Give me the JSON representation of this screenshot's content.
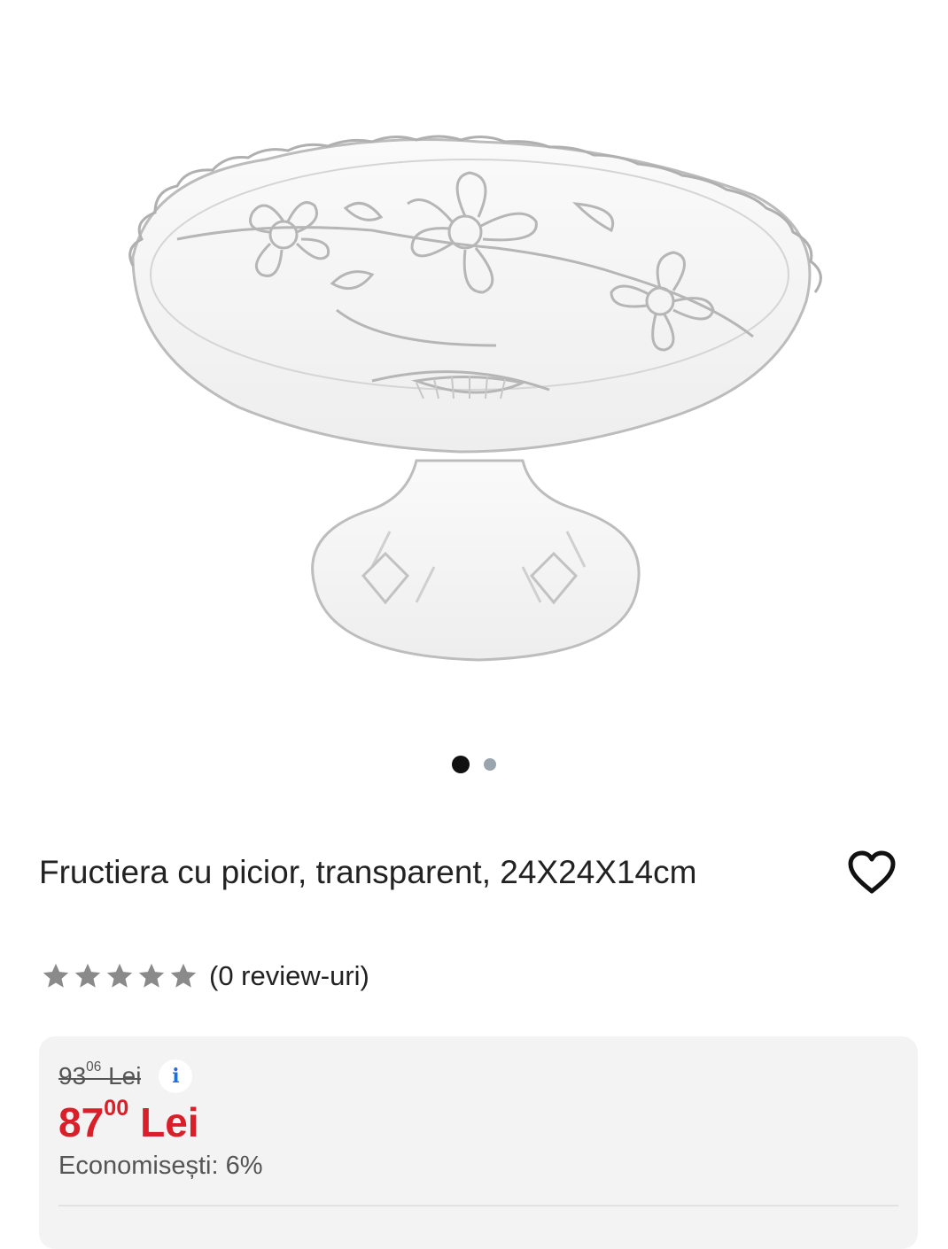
{
  "gallery": {
    "image_alt": "Fructiera cu picior, transparent",
    "active_index": 0,
    "total": 2
  },
  "product": {
    "title": "Fructiera cu picior, transparent, 24X24X14cm"
  },
  "rating": {
    "stars": 0,
    "max_stars": 5,
    "reviews_label": "(0 review-uri)"
  },
  "price": {
    "old_int": "93",
    "old_dec": "06",
    "old_currency": "Lei",
    "info_icon": "i",
    "new_int": "87",
    "new_dec": "00",
    "new_currency": "Lei",
    "saving": "Economisești: 6%"
  },
  "colors": {
    "sale_red": "#d9202a",
    "star_gray": "#8a8a8a",
    "info_blue": "#1b6fe0"
  }
}
